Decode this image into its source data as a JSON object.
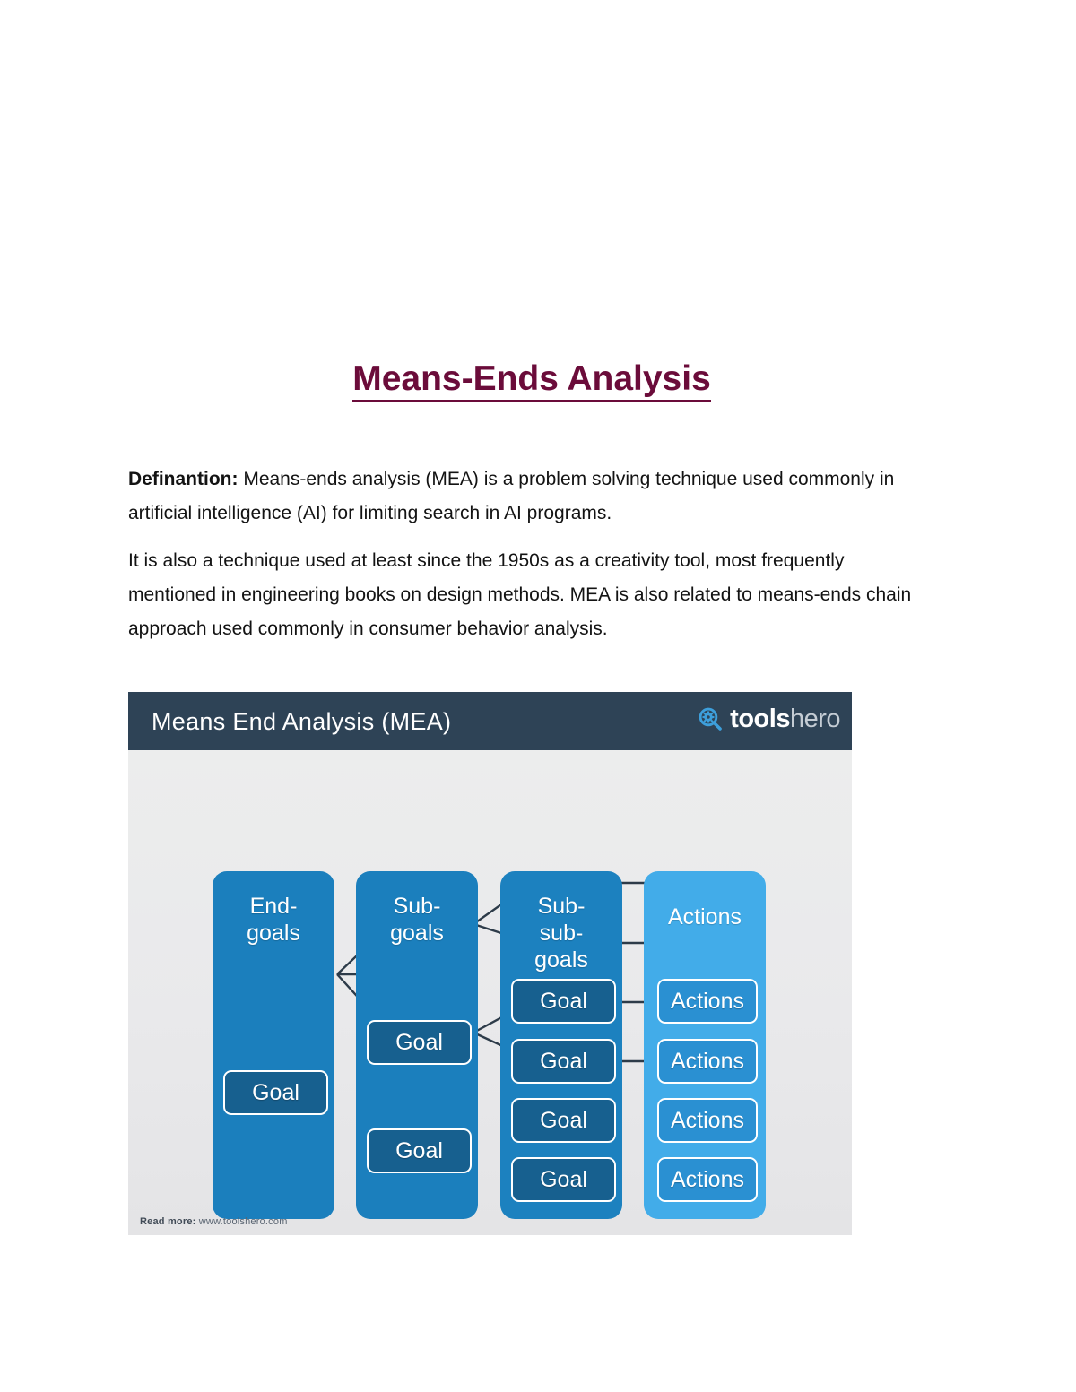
{
  "document": {
    "title": "Means-Ends Analysis ",
    "paragraphs": [
      {
        "lead": "Definantion",
        "lead_suffix": ": ",
        "text": "Means-ends analysis (MEA) is a problem solving technique used commonly in artificial intelligence (AI) for limiting search in AI programs."
      },
      {
        "lead": "",
        "lead_suffix": "",
        "text": "It is also a technique used at least since the 1950s as a creativity tool, most frequently mentioned in engineering books on design methods. MEA is also related to means-ends chain approach used commonly in consumer behavior analysis."
      }
    ],
    "title_color": "#6b0c3a",
    "body_color": "#131313"
  },
  "figure": {
    "header": {
      "title": "Means End Analysis (MEA)",
      "background": "#2e4356",
      "brand": {
        "icon": "magnifier-gear-icon",
        "icon_color": "#3d9fdb",
        "primary": "tools",
        "secondary": "hero"
      }
    },
    "canvas_background": "#e9e9eb",
    "columns": [
      {
        "label": "End-\ngoals",
        "color": "#1b7fbd"
      },
      {
        "label": "Sub-\ngoals",
        "color": "#1b7fbd"
      },
      {
        "label": "Sub-\nsub-\ngoals",
        "color": "#1c81bf"
      },
      {
        "label": "Actions",
        "color": "#42ace9"
      }
    ],
    "nodes": {
      "end_goals": [
        "Goal"
      ],
      "sub_goals": [
        "Goal",
        "Goal"
      ],
      "sub_sub_goals": [
        "Goal",
        "Goal",
        "Goal",
        "Goal"
      ],
      "actions": [
        "Actions",
        "Actions",
        "Actions",
        "Actions"
      ]
    },
    "node_colors": {
      "goal": "#17608f",
      "action": "#2a90d2",
      "border": "#ffffff",
      "connector": "#2d3b49"
    },
    "footer": {
      "label": "Read more:",
      "url": " www.toolshero.com"
    }
  }
}
